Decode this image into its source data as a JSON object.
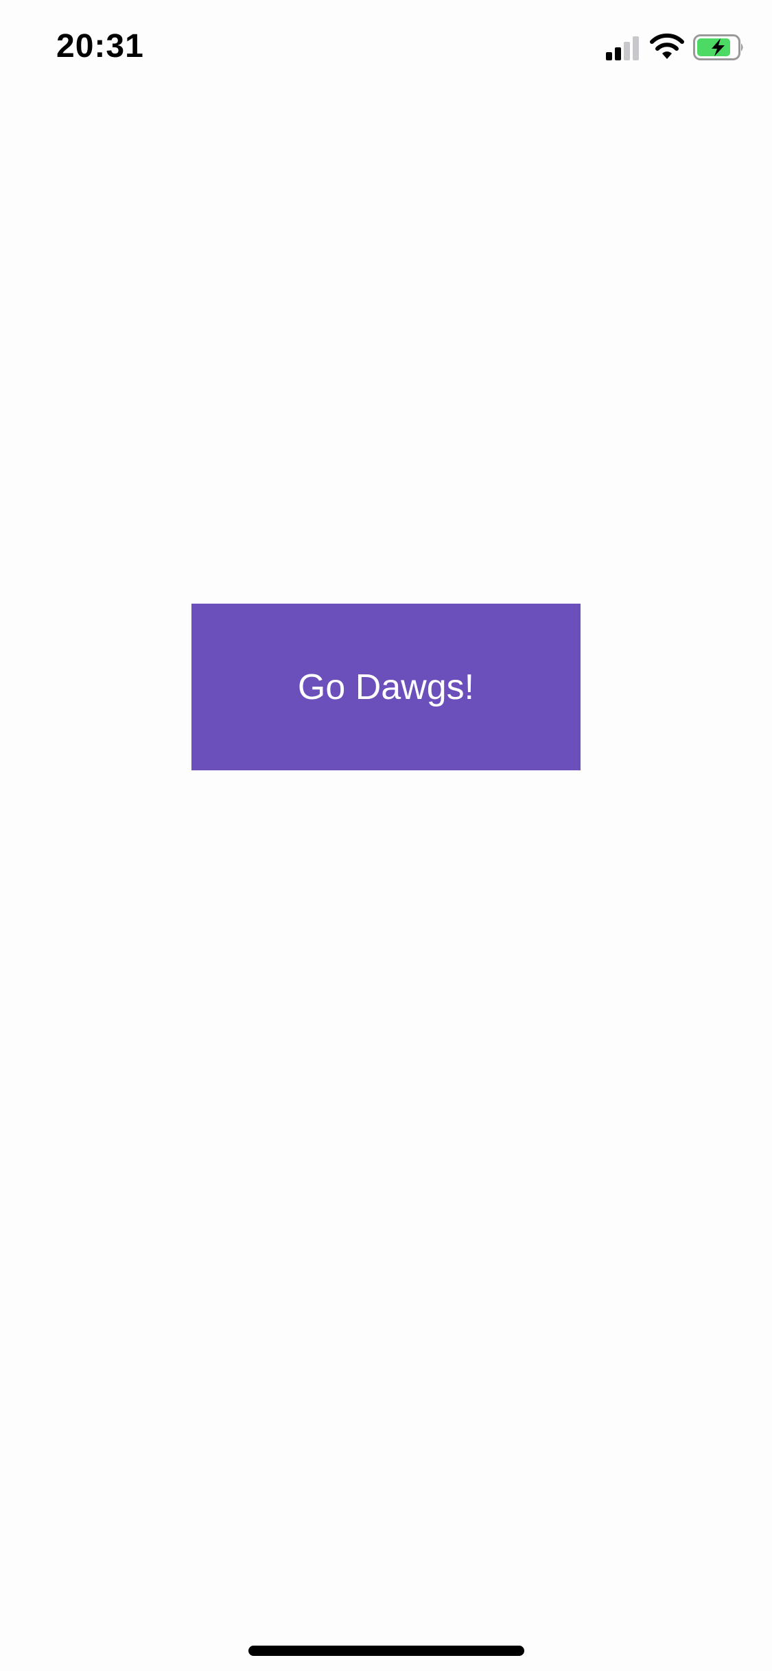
{
  "status_bar": {
    "time": "20:31",
    "icons": [
      "signal-icon",
      "wifi-icon",
      "battery-icon"
    ],
    "battery_charging": true,
    "battery_color": "#4cd964"
  },
  "main": {
    "button_label": "Go Dawgs!",
    "button_color": "#6b4fbb"
  }
}
